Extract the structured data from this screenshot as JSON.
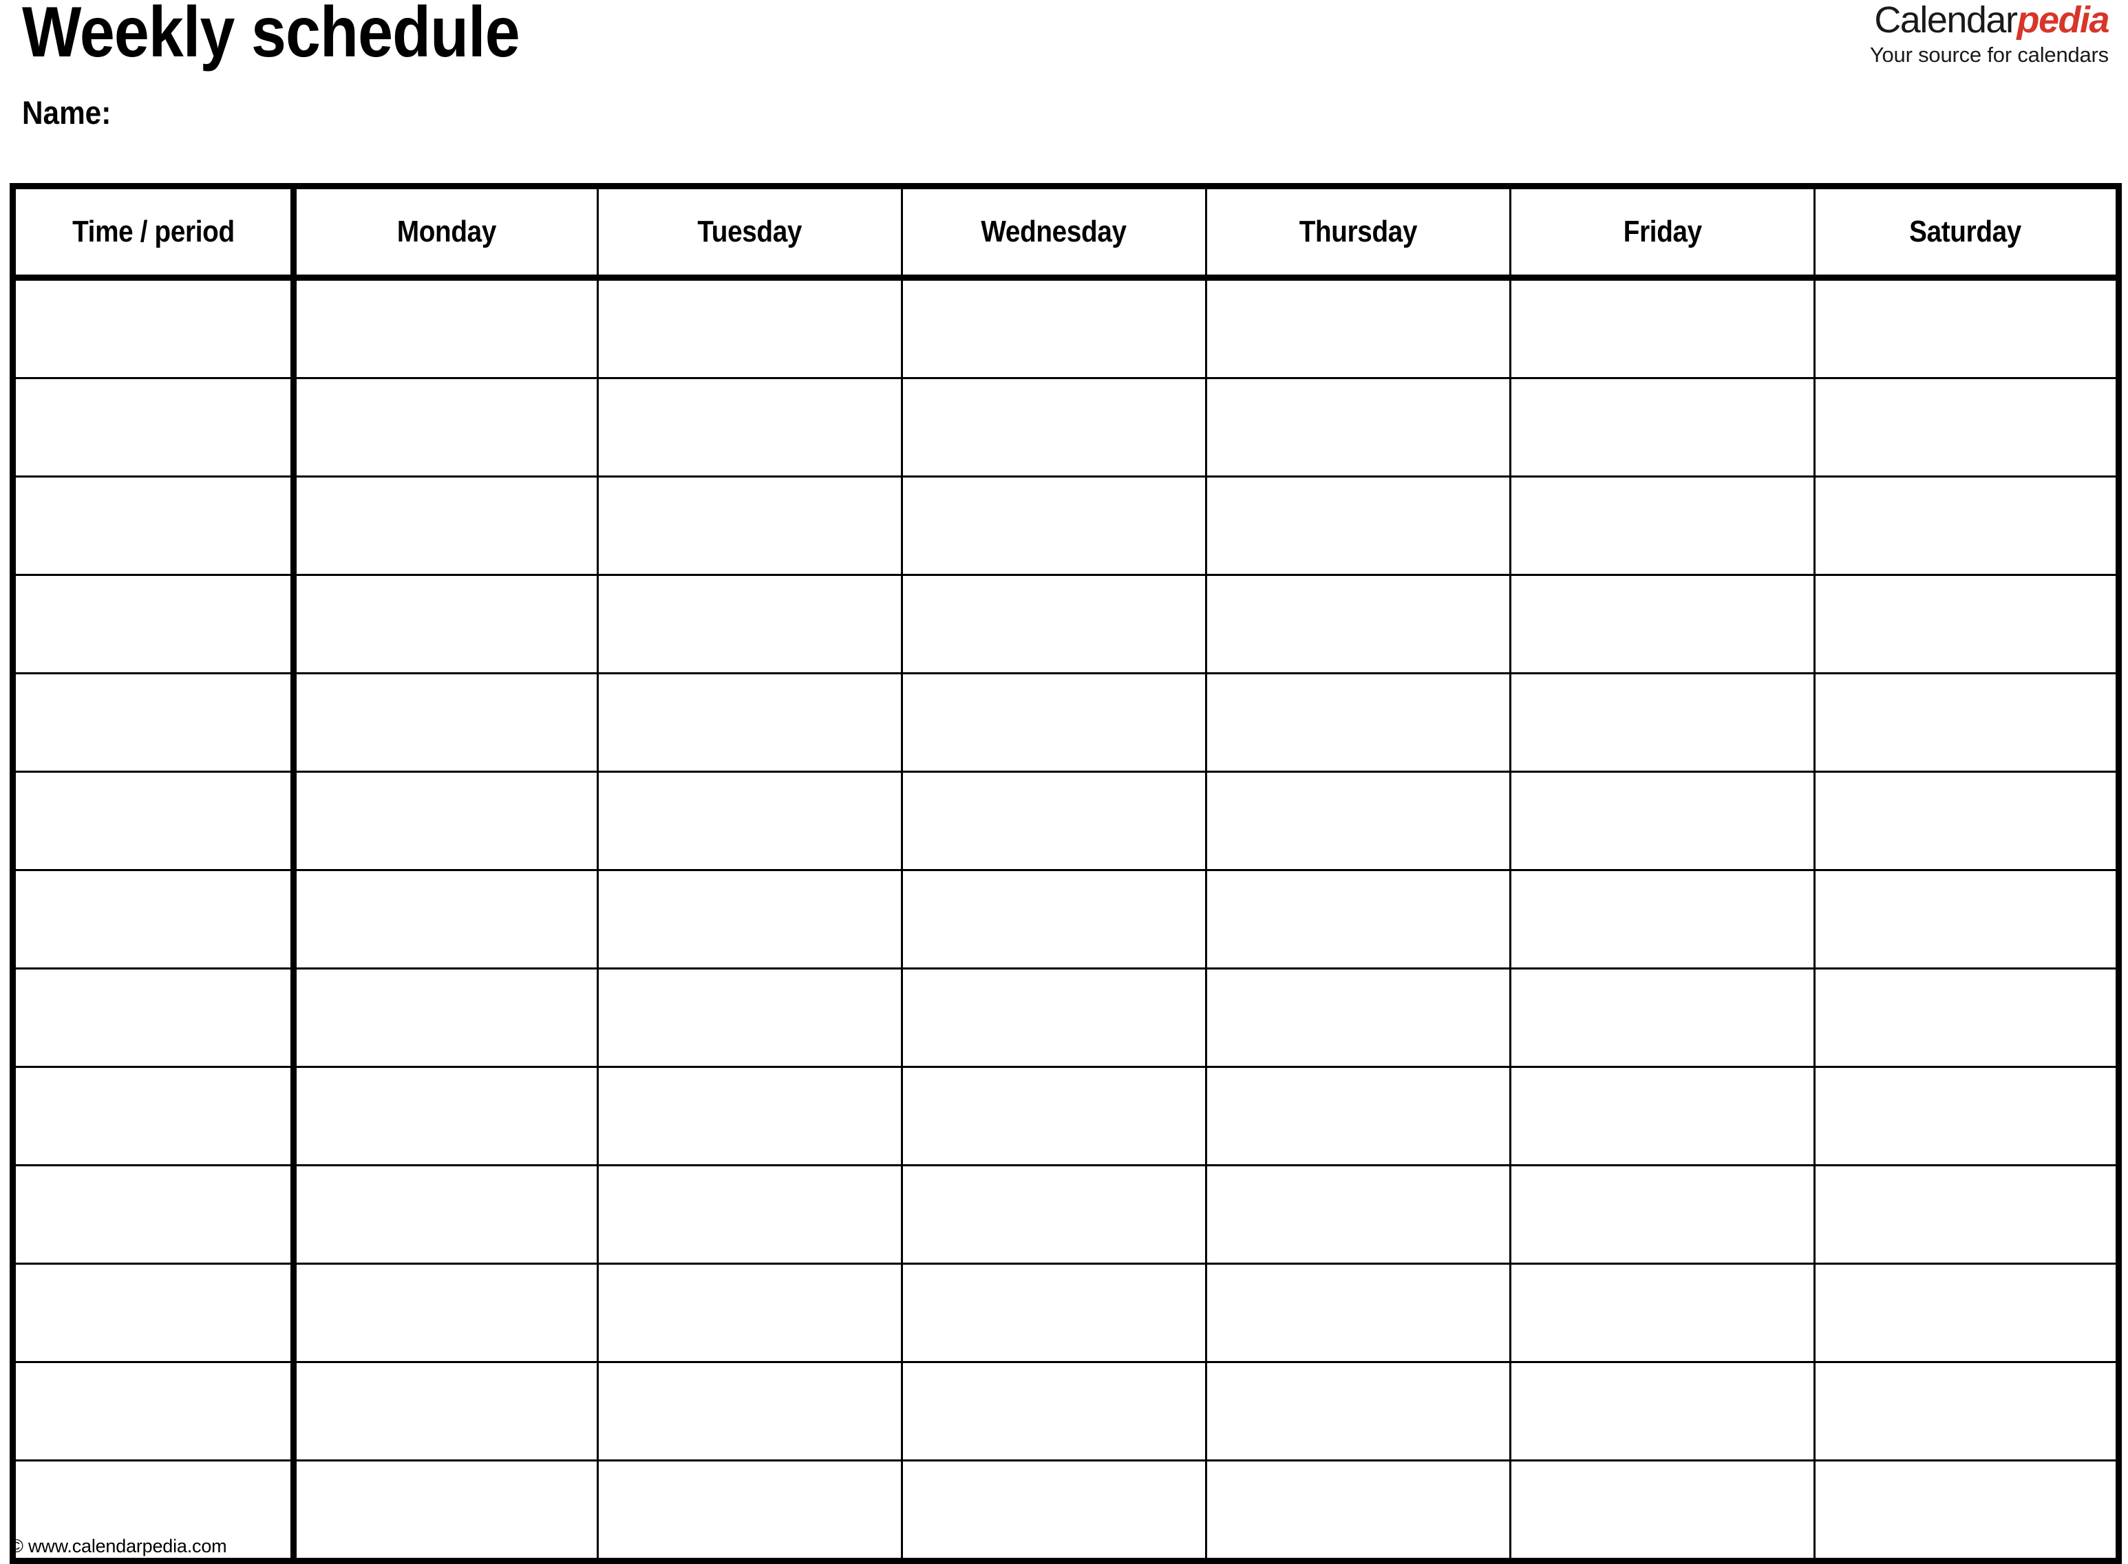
{
  "document": {
    "title": "Weekly schedule",
    "name_label": "Name:"
  },
  "brand": {
    "name_part_1": "Calendar",
    "name_part_2": "pedia",
    "tagline": "Your source for calendars",
    "accent_color": "#d8352a",
    "text_color": "#1a1a1a"
  },
  "table": {
    "columns": [
      {
        "key": "time",
        "label": "Time / period"
      },
      {
        "key": "monday",
        "label": "Monday"
      },
      {
        "key": "tuesday",
        "label": "Tuesday"
      },
      {
        "key": "wednesday",
        "label": "Wednesday"
      },
      {
        "key": "thursday",
        "label": "Thursday"
      },
      {
        "key": "friday",
        "label": "Friday"
      },
      {
        "key": "saturday",
        "label": "Saturday"
      }
    ],
    "row_count": 13,
    "rows": [
      {
        "time": "",
        "monday": "",
        "tuesday": "",
        "wednesday": "",
        "thursday": "",
        "friday": "",
        "saturday": ""
      },
      {
        "time": "",
        "monday": "",
        "tuesday": "",
        "wednesday": "",
        "thursday": "",
        "friday": "",
        "saturday": ""
      },
      {
        "time": "",
        "monday": "",
        "tuesday": "",
        "wednesday": "",
        "thursday": "",
        "friday": "",
        "saturday": ""
      },
      {
        "time": "",
        "monday": "",
        "tuesday": "",
        "wednesday": "",
        "thursday": "",
        "friday": "",
        "saturday": ""
      },
      {
        "time": "",
        "monday": "",
        "tuesday": "",
        "wednesday": "",
        "thursday": "",
        "friday": "",
        "saturday": ""
      },
      {
        "time": "",
        "monday": "",
        "tuesday": "",
        "wednesday": "",
        "thursday": "",
        "friday": "",
        "saturday": ""
      },
      {
        "time": "",
        "monday": "",
        "tuesday": "",
        "wednesday": "",
        "thursday": "",
        "friday": "",
        "saturday": ""
      },
      {
        "time": "",
        "monday": "",
        "tuesday": "",
        "wednesday": "",
        "thursday": "",
        "friday": "",
        "saturday": ""
      },
      {
        "time": "",
        "monday": "",
        "tuesday": "",
        "wednesday": "",
        "thursday": "",
        "friday": "",
        "saturday": ""
      },
      {
        "time": "",
        "monday": "",
        "tuesday": "",
        "wednesday": "",
        "thursday": "",
        "friday": "",
        "saturday": ""
      },
      {
        "time": "",
        "monday": "",
        "tuesday": "",
        "wednesday": "",
        "thursday": "",
        "friday": "",
        "saturday": ""
      },
      {
        "time": "",
        "monday": "",
        "tuesday": "",
        "wednesday": "",
        "thursday": "",
        "friday": "",
        "saturday": ""
      },
      {
        "time": "",
        "monday": "",
        "tuesday": "",
        "wednesday": "",
        "thursday": "",
        "friday": "",
        "saturday": ""
      }
    ]
  },
  "footer": {
    "copyright": "© www.calendarpedia.com"
  }
}
